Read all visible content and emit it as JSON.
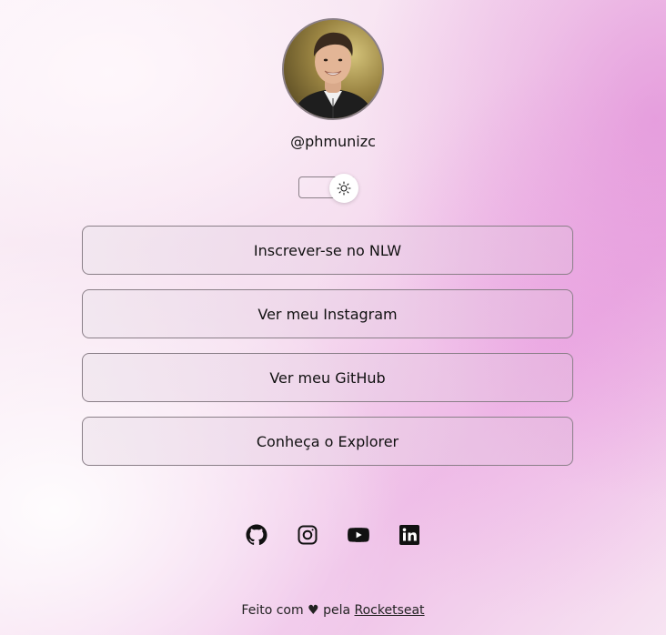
{
  "profile": {
    "username": "@phmunizc",
    "avatar_alt": "Foto de perfil"
  },
  "theme_switch": {
    "icon": "sun-icon",
    "state": "light"
  },
  "links": [
    {
      "label": "Inscrever-se no NLW"
    },
    {
      "label": "Ver meu Instagram"
    },
    {
      "label": "Ver meu GitHub"
    },
    {
      "label": "Conheça o Explorer"
    }
  ],
  "social": [
    {
      "icon": "github-icon"
    },
    {
      "icon": "instagram-icon"
    },
    {
      "icon": "youtube-icon"
    },
    {
      "icon": "linkedin-icon"
    }
  ],
  "footer": {
    "prefix": "Feito com ♥ pela ",
    "link_label": "Rocketseat"
  },
  "colors": {
    "accent_pink": "#efc1e8",
    "border": "#8a7f88",
    "text": "#111111"
  }
}
